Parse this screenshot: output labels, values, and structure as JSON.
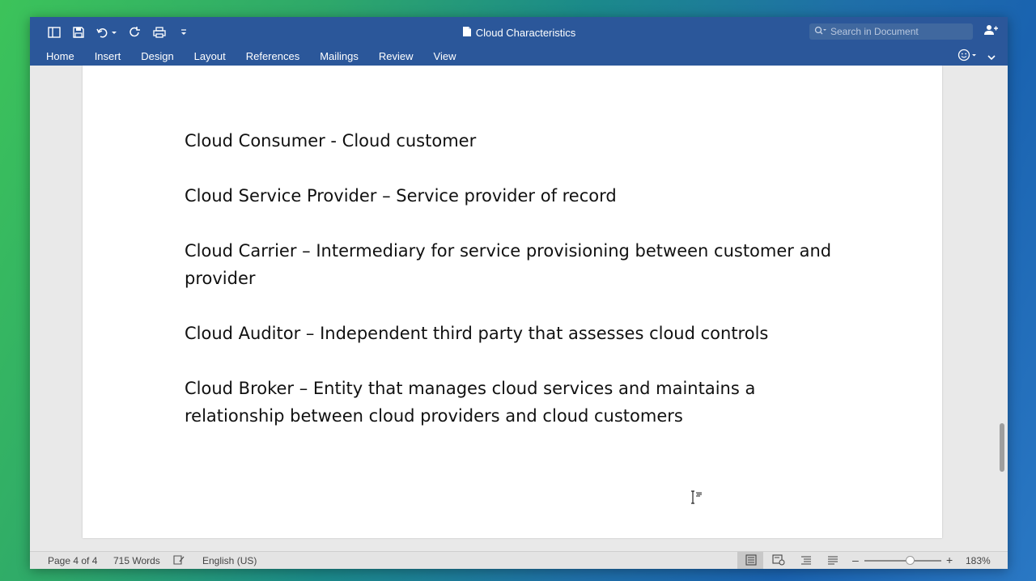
{
  "window": {
    "title": "Cloud Characteristics",
    "search_placeholder": "Search in Document"
  },
  "quick_access": [
    {
      "name": "sidebar-toggle-icon"
    },
    {
      "name": "save-icon"
    },
    {
      "name": "undo-icon"
    },
    {
      "name": "redo-icon"
    },
    {
      "name": "print-icon"
    },
    {
      "name": "customize-toolbar-icon"
    }
  ],
  "tabs": [
    {
      "label": "Home"
    },
    {
      "label": "Insert"
    },
    {
      "label": "Design"
    },
    {
      "label": "Layout"
    },
    {
      "label": "References"
    },
    {
      "label": "Mailings"
    },
    {
      "label": "Review"
    },
    {
      "label": "View"
    }
  ],
  "document": {
    "paragraphs": [
      {
        "text": "Cloud Consumer - Cloud customer"
      },
      {
        "text": "Cloud Service Provider – Service provider of record"
      },
      {
        "text": "Cloud Carrier – Intermediary for service provisioning between customer and provider"
      },
      {
        "text": "Cloud Auditor – Independent third party that assesses cloud controls"
      },
      {
        "text": "Cloud Broker – Entity that manages cloud services and maintains a relationship between cloud providers and cloud customers"
      }
    ]
  },
  "status": {
    "page": "Page 4 of 4",
    "words": "715 Words",
    "language": "English (US)",
    "zoom_minus": "–",
    "zoom_plus": "+",
    "zoom": "183%"
  },
  "colors": {
    "title_bar": "#2b579a",
    "page_background": "#ffffff",
    "text": "#111111"
  }
}
